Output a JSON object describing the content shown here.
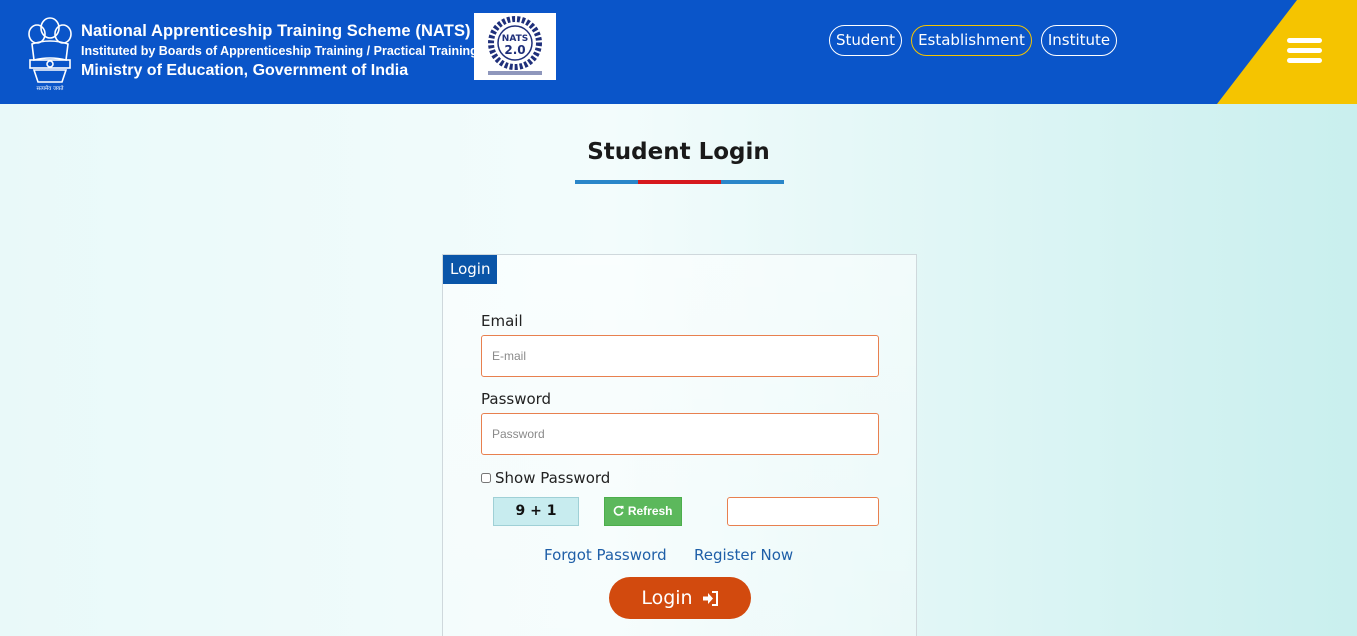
{
  "header": {
    "line1": "National Apprenticeship Training Scheme (NATS)",
    "line2": "Instituted by Boards of Apprenticeship Training / Practical Training",
    "line3": "Ministry of Education, Government of India",
    "logo_text": "NATS",
    "logo_version": "2.0",
    "emblem_caption": "सत्यमेव जयते",
    "brand_color": "#0a55c9",
    "accent_color": "#f5c400",
    "nav": [
      {
        "label": "Student"
      },
      {
        "label": "Establishment"
      },
      {
        "label": "Institute"
      }
    ]
  },
  "page": {
    "title": "Student Login"
  },
  "form": {
    "tab_label": "Login",
    "email_label": "Email",
    "email_placeholder": "E-mail",
    "password_label": "Password",
    "password_placeholder": "Password",
    "show_password_label": "Show Password",
    "captcha_text": "9 + 1",
    "refresh_label": "Refresh",
    "forgot_password": "Forgot Password",
    "register_now": "Register Now",
    "login_label": "Login",
    "button_color": "#d24a0e"
  }
}
